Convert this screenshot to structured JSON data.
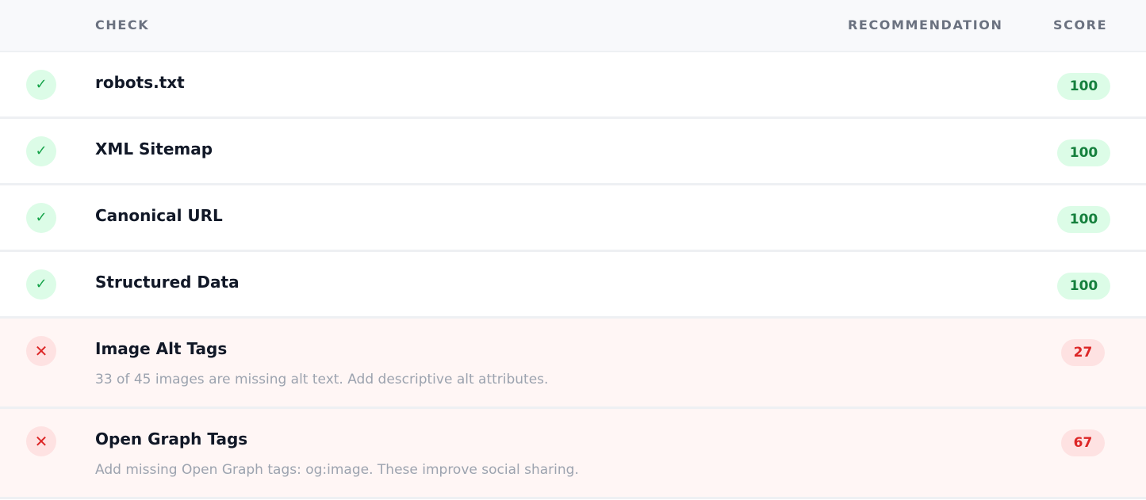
{
  "columns": {
    "check": "CHECK",
    "recommendation": "RECOMMENDATION",
    "score": "SCORE"
  },
  "rows": [
    {
      "status": "pass",
      "status_icon": "check-icon",
      "glyph": "✓",
      "name": "robots.txt",
      "recommendation": "",
      "score": "100"
    },
    {
      "status": "pass",
      "status_icon": "check-icon",
      "glyph": "✓",
      "name": "XML Sitemap",
      "recommendation": "",
      "score": "100"
    },
    {
      "status": "pass",
      "status_icon": "check-icon",
      "glyph": "✓",
      "name": "Canonical URL",
      "recommendation": "",
      "score": "100"
    },
    {
      "status": "pass",
      "status_icon": "check-icon",
      "glyph": "✓",
      "name": "Structured Data",
      "recommendation": "",
      "score": "100"
    },
    {
      "status": "fail",
      "status_icon": "x-icon",
      "glyph": "✕",
      "name": "Image Alt Tags",
      "recommendation": "33 of 45 images are missing alt text. Add descriptive alt attributes.",
      "score": "27"
    },
    {
      "status": "fail",
      "status_icon": "x-icon",
      "glyph": "✕",
      "name": "Open Graph Tags",
      "recommendation": "Add missing Open Graph tags: og:image. These improve social sharing.",
      "score": "67"
    }
  ],
  "colors": {
    "pass_bg": "#dcfce7",
    "pass_text": "#15803d",
    "fail_bg": "#fee2e2",
    "fail_text": "#dc2626",
    "fail_row_bg": "#fff6f5"
  }
}
